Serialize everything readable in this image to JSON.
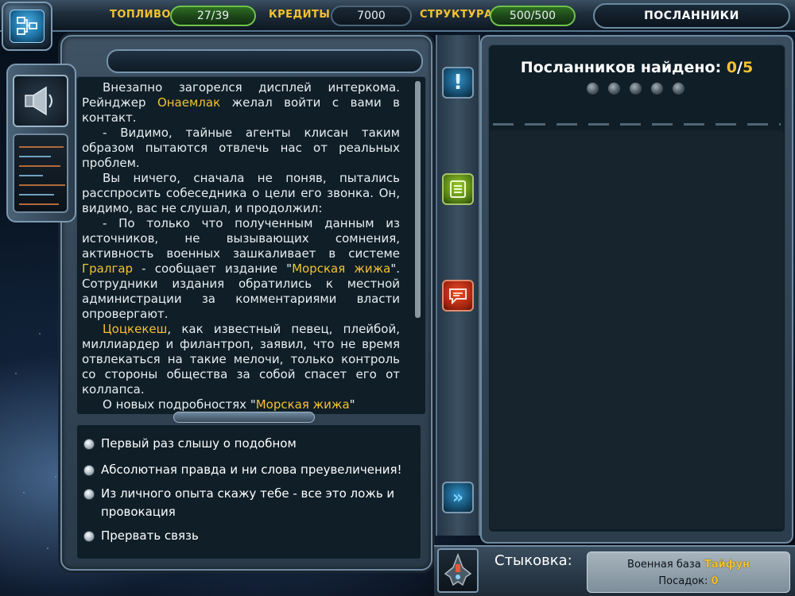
{
  "topbar": {
    "fuel_label": "ТОПЛИВО",
    "fuel_value": "27/39",
    "credits_label": "КРЕДИТЫ",
    "credits_value": "7000",
    "structure_label": "СТРУКТУРА",
    "structure_value": "500/500",
    "screen_title": "ПОСЛАННИКИ"
  },
  "story": {
    "p1_a": "Внезапно загорелся дисплей интеркома. Рейнджер ",
    "p1_name": "Онаемлак",
    "p1_b": " желал войти с вами в контакт.",
    "p2": "- Видимо, тайные агенты клисан таким образом пытаются отвлечь нас от реальных проблем.",
    "p3": "Вы ничего, сначала не поняв, пытались расспросить собеседника о цели его звонка. Он, видимо, вас не слушал, и продолжил:",
    "p4_a": "- По только что полученным данным из источников, не вызывающих сомнения, активность военных зашкаливает в системе ",
    "p4_system": "Гралгар",
    "p4_b": " - сообщает издание \"",
    "p4_paper": "Морская жижа",
    "p4_c": "\". Сотрудники издания обратились к местной администрации за комментариями власти опровергают.",
    "p5_name": "Цоцкекеш",
    "p5_b": ", как известный певец, плейбой, миллиардер и филантроп, заявил, что не время отвлекаться на такие мелочи, только контроль со стороны общества за собой спасет его от коллапса.",
    "p6_a": "О новых подробностях \"",
    "p6_paper": "Морская жижа",
    "p6_b": "\""
  },
  "answers": [
    "Первый раз слышу о подобном",
    "Абсолютная правда и ни слова преувеличения!",
    "Из личного опыта скажу тебе - все это ложь и провокация",
    "Прервать связь"
  ],
  "envoys": {
    "found_label": "Посланников найдено: ",
    "found_count": "0",
    "found_sep": "/",
    "found_total": "5"
  },
  "dock": {
    "label": "Стыковка:",
    "base_prefix": "Военная база ",
    "base_name": "Тайфун",
    "landings_label": "Посадок: ",
    "landings_value": "0"
  },
  "icons": {
    "logo": "network-icon",
    "speaker": "speaker-icon",
    "alert": "exclamation-icon",
    "list": "list-icon",
    "message": "message-icon",
    "next": "double-chevron-right-icon",
    "ship": "ship-icon"
  },
  "colors": {
    "highlight": "#f2c230",
    "panel_bg": "#0f1e27",
    "frame": "#6f8ba2"
  }
}
